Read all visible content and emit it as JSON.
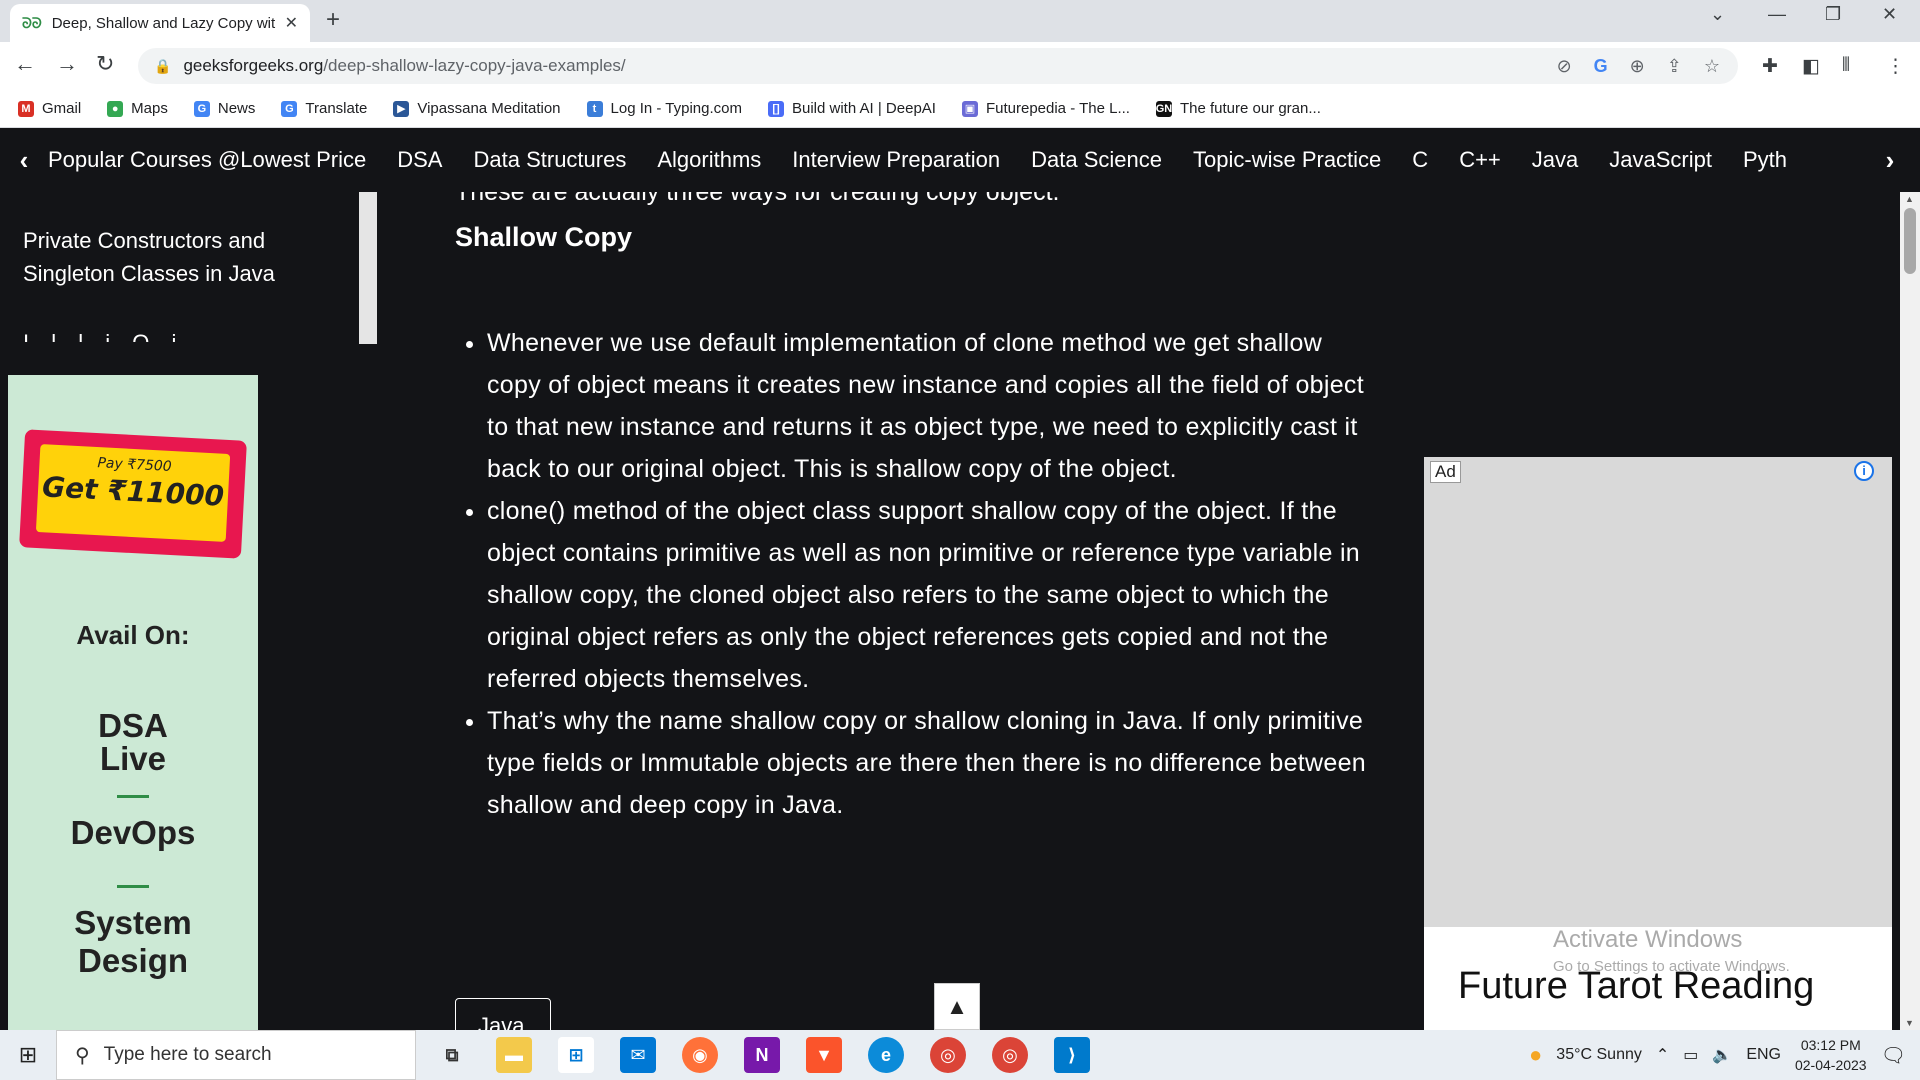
{
  "browser": {
    "tab_title": "Deep, Shallow and Lazy Copy wit",
    "new_tab": "+",
    "url_domain": "geeksforgeeks.org",
    "url_path": "/deep-shallow-lazy-copy-java-examples/",
    "win_min": "—",
    "win_restore": "❐",
    "win_close": "✕",
    "tab_list": "⌄"
  },
  "bookmarks": [
    {
      "label": "Gmail",
      "icon": "gmail-icon",
      "glyph": "M",
      "color": "#d93025"
    },
    {
      "label": "Maps",
      "icon": "maps-icon",
      "glyph": "●",
      "color": "#34a853"
    },
    {
      "label": "News",
      "icon": "news-icon",
      "glyph": "G",
      "color": "#4285f4"
    },
    {
      "label": "Translate",
      "icon": "translate-icon",
      "glyph": "G",
      "color": "#4285f4"
    },
    {
      "label": "Vipassana Meditation",
      "icon": "vipassana-icon",
      "glyph": "▶",
      "color": "#2b5797"
    },
    {
      "label": "Log In - Typing.com",
      "icon": "typing-icon",
      "glyph": "t",
      "color": "#3b7dd8"
    },
    {
      "label": "Build with AI | DeepAI",
      "icon": "deepai-icon",
      "glyph": "[]",
      "color": "#4a6cf7"
    },
    {
      "label": "Futurepedia - The L...",
      "icon": "futurepedia-icon",
      "glyph": "▣",
      "color": "#6b6bd6"
    },
    {
      "label": "The future our gran...",
      "icon": "gn-icon",
      "glyph": "GN",
      "color": "#111111"
    }
  ],
  "sitenav": {
    "items": [
      "Popular Courses @Lowest Price",
      "DSA",
      "Data Structures",
      "Algorithms",
      "Interview Preparation",
      "Data Science",
      "Topic-wise Practice",
      "C",
      "C++",
      "Java",
      "JavaScript",
      "Pyth"
    ]
  },
  "sidebar": {
    "link": "Private Constructors and Singleton Classes in Java",
    "cut": "I   l  l  i    O    i"
  },
  "leftad": {
    "pay": "Pay ₹7500",
    "get": "Get ₹11000",
    "avail": "Avail On:",
    "items": [
      "DSA",
      "Live",
      "DevOps",
      "System",
      "Design"
    ]
  },
  "article": {
    "cutline": "These are actually three ways for creating copy object.",
    "heading": "Shallow Copy",
    "bullets": [
      "Whenever we use default implementation of clone method we get shallow copy of object means it creates new instance and copies all the field of object to that new instance and returns it as object type, we need to explicitly cast it back to our original object. This is shallow copy of the object.",
      "clone() method of the object class support shallow copy of the object. If the object contains primitive as well as non primitive or reference type variable in shallow copy, the cloned object also refers to the same object to which the original object refers as only the object references gets copied and not the referred objects themselves.",
      "That’s why the name shallow copy or shallow cloning in Java. If only primitive type fields or Immutable objects are there then there is no difference between shallow and deep copy in Java."
    ],
    "tag": "Java"
  },
  "rightad": {
    "badge": "Ad",
    "info": "i",
    "title": "Future Tarot Reading"
  },
  "watermark": {
    "line1": "Activate Windows",
    "line2": "Go to Settings to activate Windows."
  },
  "taskbar": {
    "search_placeholder": "Type here to search",
    "weather": "35°C  Sunny",
    "lang": "ENG",
    "time": "03:12 PM",
    "date": "02-04-2023"
  }
}
